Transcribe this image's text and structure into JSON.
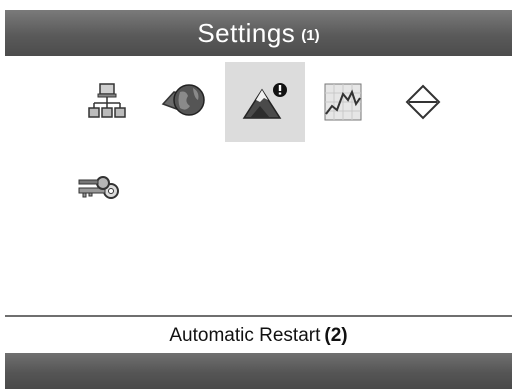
{
  "header": {
    "title": "Settings",
    "marker": "(1)"
  },
  "icons": [
    {
      "name": "network-icon",
      "selected": false
    },
    {
      "name": "globe-icon",
      "selected": false
    },
    {
      "name": "mountain-alert-icon",
      "selected": true
    },
    {
      "name": "chart-icon",
      "selected": false
    },
    {
      "name": "diamond-arrows-icon",
      "selected": false
    },
    {
      "name": "keys-icon",
      "selected": false
    }
  ],
  "status": {
    "label": "Automatic Restart",
    "marker": "(2)"
  },
  "colors": {
    "bar": "#5a5a5a",
    "selected_tile": "#dcdcdc",
    "background": "#ffffff"
  }
}
